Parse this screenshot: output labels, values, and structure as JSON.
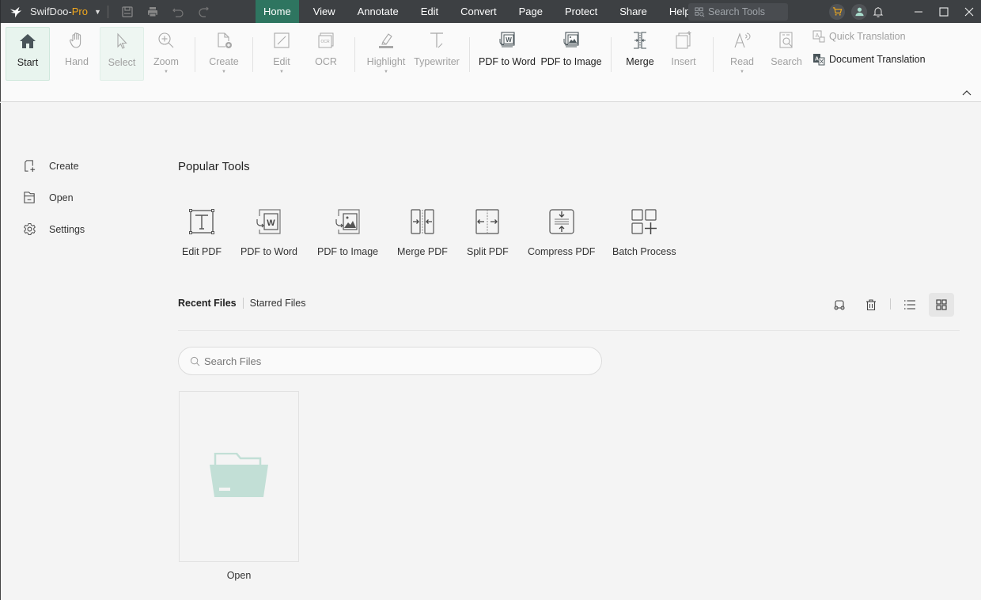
{
  "titlebar": {
    "brand_name": "SwifDoo-",
    "brand_suffix": "Pro",
    "menu": [
      {
        "label": "Home",
        "active": true
      },
      {
        "label": "View"
      },
      {
        "label": "Annotate"
      },
      {
        "label": "Edit"
      },
      {
        "label": "Convert"
      },
      {
        "label": "Page"
      },
      {
        "label": "Protect"
      },
      {
        "label": "Share"
      },
      {
        "label": "Help"
      }
    ],
    "search_placeholder": "Search Tools"
  },
  "ribbon": {
    "start": "Start",
    "hand": "Hand",
    "select": "Select",
    "zoom": "Zoom",
    "create": "Create",
    "edit": "Edit",
    "ocr": "OCR",
    "highlight": "Highlight",
    "typewriter": "Typewriter",
    "pdf_to_word": "PDF to Word",
    "pdf_to_image": "PDF to Image",
    "merge": "Merge",
    "insert": "Insert",
    "read": "Read",
    "search": "Search",
    "quick_translation": "Quick Translation",
    "document_translation": "Document Translation"
  },
  "leftnav": {
    "items": [
      {
        "label": "Create"
      },
      {
        "label": "Open"
      },
      {
        "label": "Settings"
      }
    ]
  },
  "main": {
    "popular_title": "Popular Tools",
    "tools": [
      {
        "label": "Edit PDF"
      },
      {
        "label": "PDF to Word"
      },
      {
        "label": "PDF to Image"
      },
      {
        "label": "Merge PDF"
      },
      {
        "label": "Split PDF"
      },
      {
        "label": "Compress PDF"
      },
      {
        "label": "Batch Process"
      }
    ],
    "tabs": {
      "recent": "Recent Files",
      "starred": "Starred Files"
    },
    "search_placeholder": "Search Files",
    "search_value": "",
    "file_card_label": "Open"
  },
  "colors": {
    "accent": "#2e7560",
    "brand_pro": "#f2a81d",
    "titlebar_bg": "#3d4043",
    "folder": "#c2dfd6"
  }
}
